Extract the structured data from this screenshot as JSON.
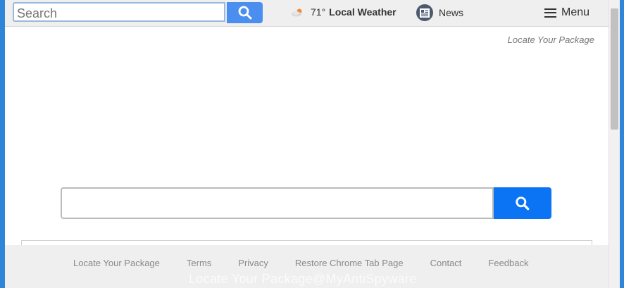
{
  "topbar": {
    "search_placeholder": "Search",
    "weather": {
      "temperature": "71°",
      "label": "Local Weather",
      "icon": "weather-cloud-sun-icon"
    },
    "news_label": "News",
    "menu_label": "Menu"
  },
  "main": {
    "locate_link": "Locate Your Package",
    "search_value": ""
  },
  "footer": {
    "links": [
      "Locate Your Package",
      "Terms",
      "Privacy",
      "Restore Chrome Tab Page",
      "Contact",
      "Feedback"
    ]
  },
  "watermark": "Locate Your Package@MyAntiSpyware",
  "colors": {
    "accent_blue": "#0a74f5",
    "top_search_button": "#4a8ef0",
    "desktop_blue": "#2f86d8"
  }
}
